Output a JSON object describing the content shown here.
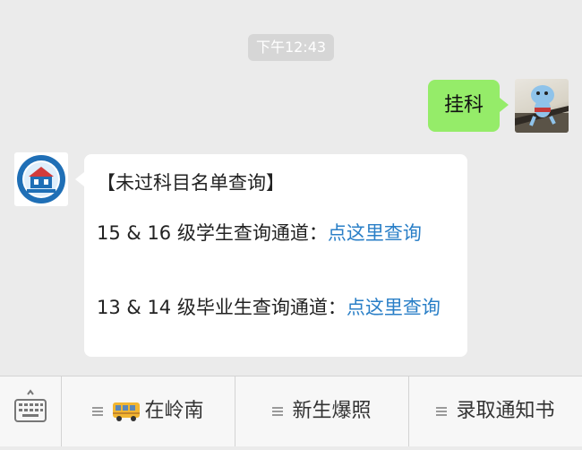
{
  "chat": {
    "timestamp": "下午12:43",
    "outgoing_message": "挂科",
    "incoming": {
      "title": "【未过科目名单查询】",
      "line1_text": "15 & 16 级学生查询通道：",
      "line1_link": "点这里查询",
      "line2_text": "13 & 14 级毕业生查询通道：",
      "line2_link": "点这里查询"
    }
  },
  "menu": {
    "items": [
      {
        "label": "在岭南",
        "icon": "bus-icon"
      },
      {
        "label": "新生爆照",
        "icon": "menu-icon"
      },
      {
        "label": "录取通知书",
        "icon": "menu-icon"
      }
    ]
  },
  "colors": {
    "background": "#ebebeb",
    "outgoing_bubble": "#95ec69",
    "link": "#2a7fc7"
  }
}
